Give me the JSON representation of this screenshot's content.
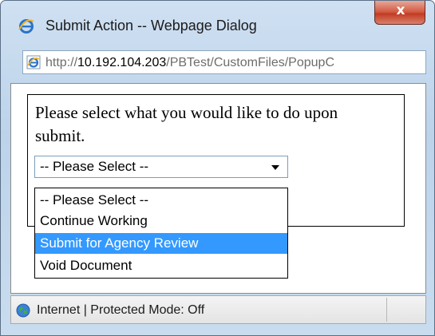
{
  "window": {
    "title": "Submit Action -- Webpage Dialog",
    "close_label": "x",
    "title_icon": "ie-icon"
  },
  "address_bar": {
    "prefix": "http://",
    "host": "10.192.104.203",
    "path": "/PBTest/CustomFiles/PopupC",
    "icon": "ie-page-icon"
  },
  "content": {
    "prompt": "Please select what you would like to do upon submit.",
    "select": {
      "value": "-- Please Select --",
      "options": [
        "-- Please Select --",
        "Continue Working",
        "Submit for Agency Review",
        "Void Document"
      ],
      "highlighted": "Submit for Agency Review"
    }
  },
  "status_bar": {
    "zone": "Internet | Protected Mode: Off",
    "icon": "globe-icon"
  },
  "colors": {
    "highlight": "#3399ff",
    "close_button": "#c23a22",
    "frame": "#bcd3ea"
  }
}
